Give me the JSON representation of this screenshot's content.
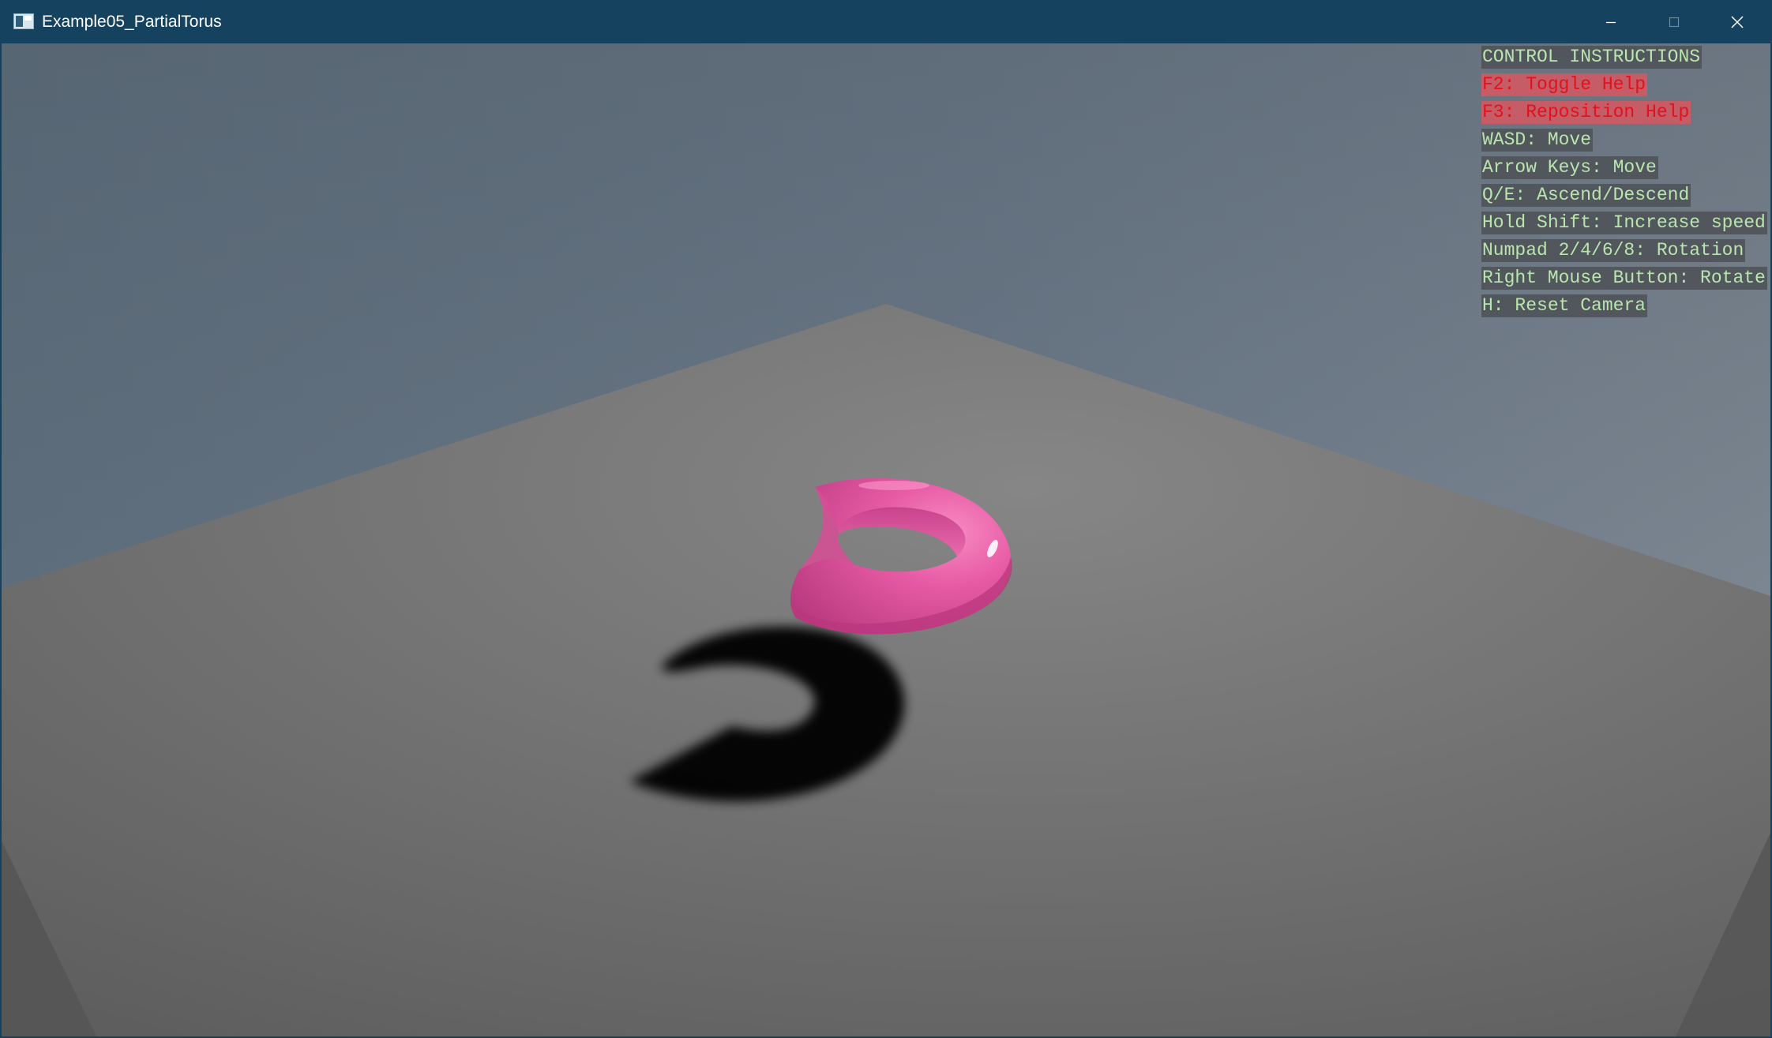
{
  "window": {
    "title": "Example05_PartialTorus",
    "app_icon": "window-app-icon",
    "controls": {
      "minimize_icon": "minimize-icon",
      "maximize_icon": "maximize-icon",
      "close_icon": "close-icon"
    }
  },
  "help": {
    "lines": [
      {
        "text": "CONTROL INSTRUCTIONS",
        "highlight": false
      },
      {
        "text": "F2: Toggle Help",
        "highlight": true
      },
      {
        "text": "F3: Reposition Help",
        "highlight": true
      },
      {
        "text": "WASD: Move",
        "highlight": false
      },
      {
        "text": "Arrow Keys: Move",
        "highlight": false
      },
      {
        "text": "Q/E: Ascend/Descend",
        "highlight": false
      },
      {
        "text": "Hold Shift: Increase speed",
        "highlight": false
      },
      {
        "text": "Numpad 2/4/6/8: Rotation",
        "highlight": false
      },
      {
        "text": "Right Mouse Button: Rotate",
        "highlight": false
      },
      {
        "text": "H: Reset Camera",
        "highlight": false
      }
    ]
  },
  "scene": {
    "object": "partial-torus",
    "colors": {
      "titlebar": "#14425f",
      "torus": "#e2559e",
      "floor": "#777777",
      "shadow": "#000000",
      "help_text": "#b9e5ae",
      "help_highlight_text": "#e2111e"
    }
  }
}
